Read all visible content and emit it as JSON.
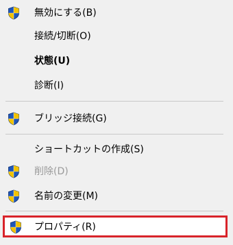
{
  "menu": {
    "items": [
      {
        "label": "無効にする(B)",
        "shield": true
      },
      {
        "label": "接続/切断(O)",
        "shield": false
      },
      {
        "label": "状態(U)",
        "shield": false,
        "bold": true
      },
      {
        "label": "診断(I)",
        "shield": false
      },
      {
        "label": "ブリッジ接続(G)",
        "shield": true
      },
      {
        "label": "ショートカットの作成(S)",
        "shield": false
      },
      {
        "label": "削除(D)",
        "shield": true,
        "disabled": true
      },
      {
        "label": "名前の変更(M)",
        "shield": true
      },
      {
        "label": "プロパティ(R)",
        "shield": true,
        "highlighted": true
      }
    ]
  },
  "colors": {
    "background": "#f0f0f0",
    "separator": "#c8c8c8",
    "highlight_border": "#d8232a",
    "shield_blue": "#1f57b8",
    "shield_yellow": "#f2c200",
    "disabled_text": "#9a9a9a"
  }
}
